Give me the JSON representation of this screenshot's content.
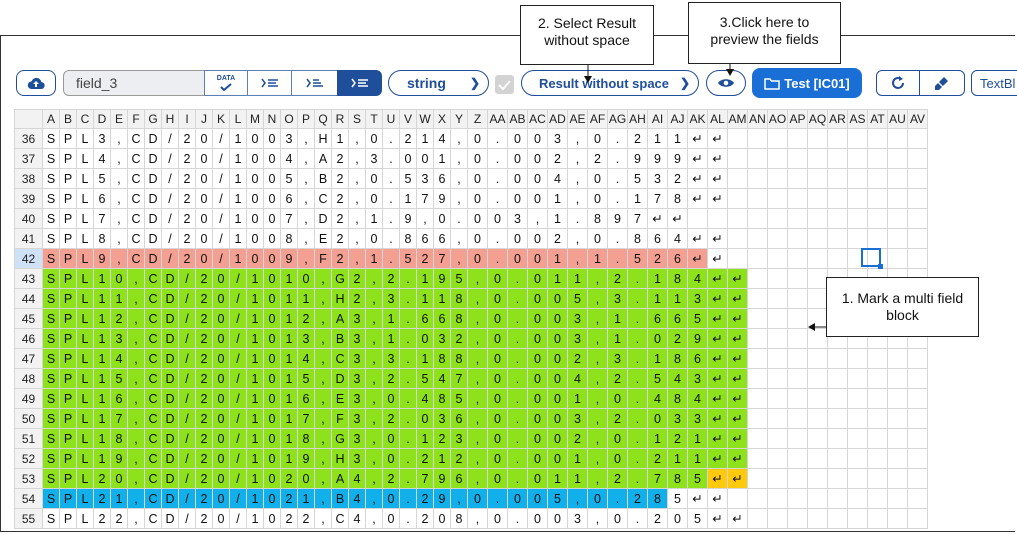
{
  "callouts": {
    "select_result": "2. Select Result without space",
    "preview": "3.Click here to preview the fields",
    "mark_block": "1. Mark a multi field block"
  },
  "toolbar": {
    "field_name": "field_3",
    "data_label": "DATA",
    "type_select": "string",
    "result_select": "Result without space",
    "test_label": "Test [IC01]",
    "textbl_label": "TextBl"
  },
  "columns": [
    "A",
    "B",
    "C",
    "D",
    "E",
    "F",
    "G",
    "H",
    "I",
    "J",
    "K",
    "L",
    "M",
    "N",
    "O",
    "P",
    "Q",
    "R",
    "S",
    "T",
    "U",
    "V",
    "W",
    "X",
    "Y",
    "Z",
    "AA",
    "AB",
    "AC",
    "AD",
    "AE",
    "AF",
    "AG",
    "AH",
    "AI",
    "AJ",
    "AK",
    "AL",
    "AM",
    "AN",
    "AO",
    "AP",
    "AQ",
    "AR",
    "AS",
    "AT",
    "AU",
    "AV"
  ],
  "selected_column": "AP",
  "rows": [
    {
      "n": "36",
      "t": "SPL3,CD/20/1003,H1,0.214,0.003,0.211↵↵"
    },
    {
      "n": "37",
      "t": "SPL4,CD/20/1004,A2,3.001,0.002,2.999↵↵"
    },
    {
      "n": "38",
      "t": "SPL5,CD/20/1005,B2,0.536,0.004,0.532↵↵"
    },
    {
      "n": "39",
      "t": "SPL6,CD/20/1006,C2,0.179,0.001,0.178↵↵"
    },
    {
      "n": "40",
      "t": "SPL7,CD/20/1007,D2,1.9,0.003,1.897↵↵"
    },
    {
      "n": "41",
      "t": "SPL8,CD/20/1008,E2,0.866,0.002,0.864↵↵"
    },
    {
      "n": "42",
      "t": "SPL9,CD/20/1009,F2,1.527,0.001,1.526↵↵"
    },
    {
      "n": "43",
      "t": "SPL10,CD/20/1010,G2,2.195,0.011,2.184↵↵"
    },
    {
      "n": "44",
      "t": "SPL11,CD/20/1011,H2,3.118,0.005,3.113↵↵"
    },
    {
      "n": "45",
      "t": "SPL12,CD/20/1012,A3,1.668,0.003,1.665↵↵"
    },
    {
      "n": "46",
      "t": "SPL13,CD/20/1013,B3,1.032,0.003,1.029↵↵"
    },
    {
      "n": "47",
      "t": "SPL14,CD/20/1014,C3,3.188,0.002,3.186↵↵"
    },
    {
      "n": "48",
      "t": "SPL15,CD/20/1015,D3,2.547,0.004,2.543↵↵"
    },
    {
      "n": "49",
      "t": "SPL16,CD/20/1016,E3,0.485,0.001,0.484↵↵"
    },
    {
      "n": "50",
      "t": "SPL17,CD/20/1017,F3,2.036,0.003,2.033↵↵"
    },
    {
      "n": "51",
      "t": "SPL18,CD/20/1018,G3,0.123,0.002,0.121↵↵"
    },
    {
      "n": "52",
      "t": "SPL19,CD/20/1019,H3,0.212,0.001,0.211↵↵"
    },
    {
      "n": "53",
      "t": "SPL20,CD/20/1020,A4,2.796,0.011,2.785↵↵"
    },
    {
      "n": "54",
      "t": "SPL21,CD/20/1021,B4,0.29,0.005,0.285↵↵"
    },
    {
      "n": "55",
      "t": "SPL22,CD/20/1022,C4,0.208,0.003,0.205↵↵"
    }
  ],
  "colors": {
    "accent": "#1f4e9a",
    "test_button": "#1a6fd6",
    "red_row": "#f3a092",
    "green_block": "#8ee21b",
    "blue_row": "#12b0ea",
    "yellow_cells": "#ffc90e"
  }
}
